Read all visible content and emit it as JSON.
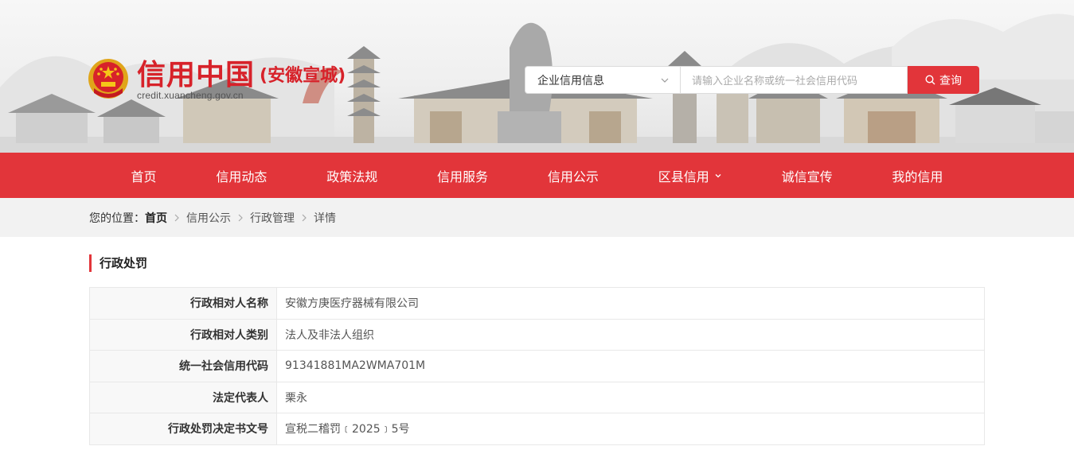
{
  "header": {
    "logo_title": "信用中国",
    "logo_region": "(安徽宣城)",
    "logo_url": "credit.xuancheng.gov.cn",
    "search": {
      "select_value": "企业信用信息",
      "placeholder": "请输入企业名称或统一社会信用代码",
      "button_label": "查询"
    }
  },
  "nav": {
    "items": [
      {
        "label": "首页"
      },
      {
        "label": "信用动态"
      },
      {
        "label": "政策法规"
      },
      {
        "label": "信用服务"
      },
      {
        "label": "信用公示"
      },
      {
        "label": "区县信用"
      },
      {
        "label": "诚信宣传"
      },
      {
        "label": "我的信用"
      }
    ]
  },
  "breadcrumb": {
    "prefix": "您的位置：",
    "items": [
      "首页",
      "信用公示",
      "行政管理",
      "详情"
    ]
  },
  "section": {
    "title": "行政处罚",
    "rows": [
      {
        "key": "行政相对人名称",
        "value": "安徽方庚医疗器械有限公司"
      },
      {
        "key": "行政相对人类别",
        "value": "法人及非法人组织"
      },
      {
        "key": "统一社会信用代码",
        "value": "91341881MA2WMA701M"
      },
      {
        "key": "法定代表人",
        "value": "栗永"
      },
      {
        "key": "行政处罚决定书文号",
        "value": "宣税二稽罚﹝2025﹞5号"
      }
    ]
  },
  "colors": {
    "brand_red": "#e2353a",
    "logo_red": "#d7222a"
  }
}
